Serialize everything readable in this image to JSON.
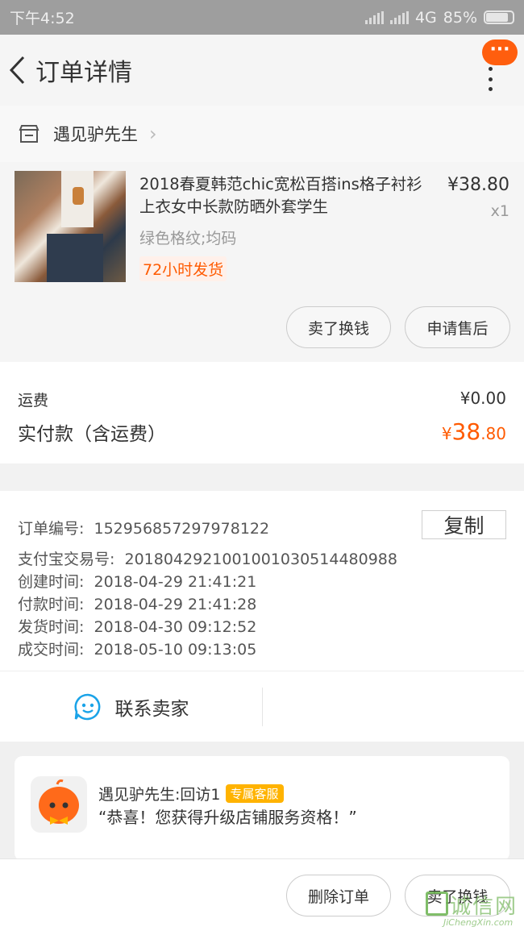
{
  "status": {
    "time": "下午4:52",
    "network": "4G",
    "battery": "85%"
  },
  "nav": {
    "title": "订单详情",
    "more_glyph": "···"
  },
  "shop": {
    "name": "遇见驴先生"
  },
  "product": {
    "title": "2018春夏韩范chic宽松百搭ins格子衬衫上衣女中长款防晒外套学生",
    "price": "¥38.80",
    "qty": "x1",
    "spec": "绿色格纹;均码",
    "tag": "72小时发货",
    "btn_sell": "卖了换钱",
    "btn_aftersale": "申请售后"
  },
  "fee": {
    "shipping_label": "运费",
    "shipping_value": "¥0.00",
    "paid_label": "实付款（含运费）",
    "paid_currency": "¥",
    "paid_int": "38",
    "paid_dec": ".80"
  },
  "order": {
    "copy_label": "复制",
    "rows": [
      {
        "k": "订单编号:",
        "v": "152956857297978122"
      },
      {
        "k": "支付宝交易号:",
        "v": "2018042921001001030514480988"
      },
      {
        "k": "创建时间:",
        "v": "2018-04-29 21:41:21"
      },
      {
        "k": "付款时间:",
        "v": "2018-04-29 21:41:28"
      },
      {
        "k": "发货时间:",
        "v": "2018-04-30 09:12:52"
      },
      {
        "k": "成交时间:",
        "v": "2018-05-10 09:13:05"
      }
    ]
  },
  "contact": {
    "label": "联系卖家"
  },
  "message": {
    "name": "遇见驴先生:回访1",
    "badge": "专属客服",
    "text": "“恭喜！您获得升级店铺服务资格！”"
  },
  "bottom": {
    "delete_label": "删除订单",
    "sell_label": "卖了换钱"
  },
  "watermark": {
    "chinese": "诚信网",
    "english": "JiChengXin.com"
  },
  "colors": {
    "accent": "#ff5a00",
    "badge": "#ffb300",
    "contact_icon": "#1aa3e8"
  }
}
